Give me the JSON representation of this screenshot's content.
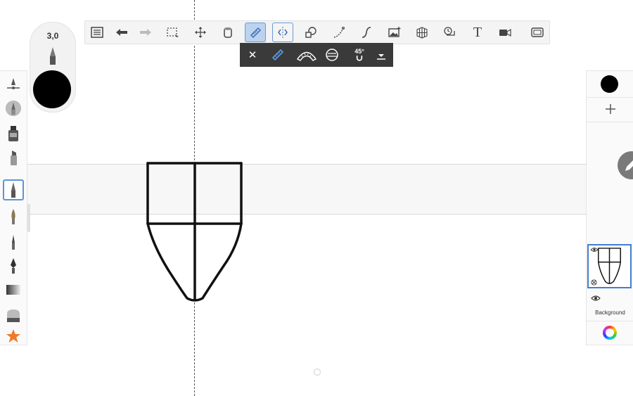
{
  "brush": {
    "size_label": "3,0",
    "color": "#000000"
  },
  "toolbar": {
    "items": [
      "layers-list",
      "undo",
      "redo",
      "selection",
      "transform",
      "fill",
      "ruler",
      "symmetry",
      "shapes",
      "curve",
      "stroke",
      "image",
      "perspective",
      "time-lapse",
      "text",
      "video",
      "fullscreen"
    ],
    "active": "ruler",
    "text_label": "T"
  },
  "ruler_bar": {
    "close_label": "✕",
    "angle_label": "45°"
  },
  "layers": {
    "background_label": "Background",
    "current_color": "#000000"
  },
  "colors": {
    "accent": "#5b94dc",
    "subbar": "#3a3a3a"
  }
}
